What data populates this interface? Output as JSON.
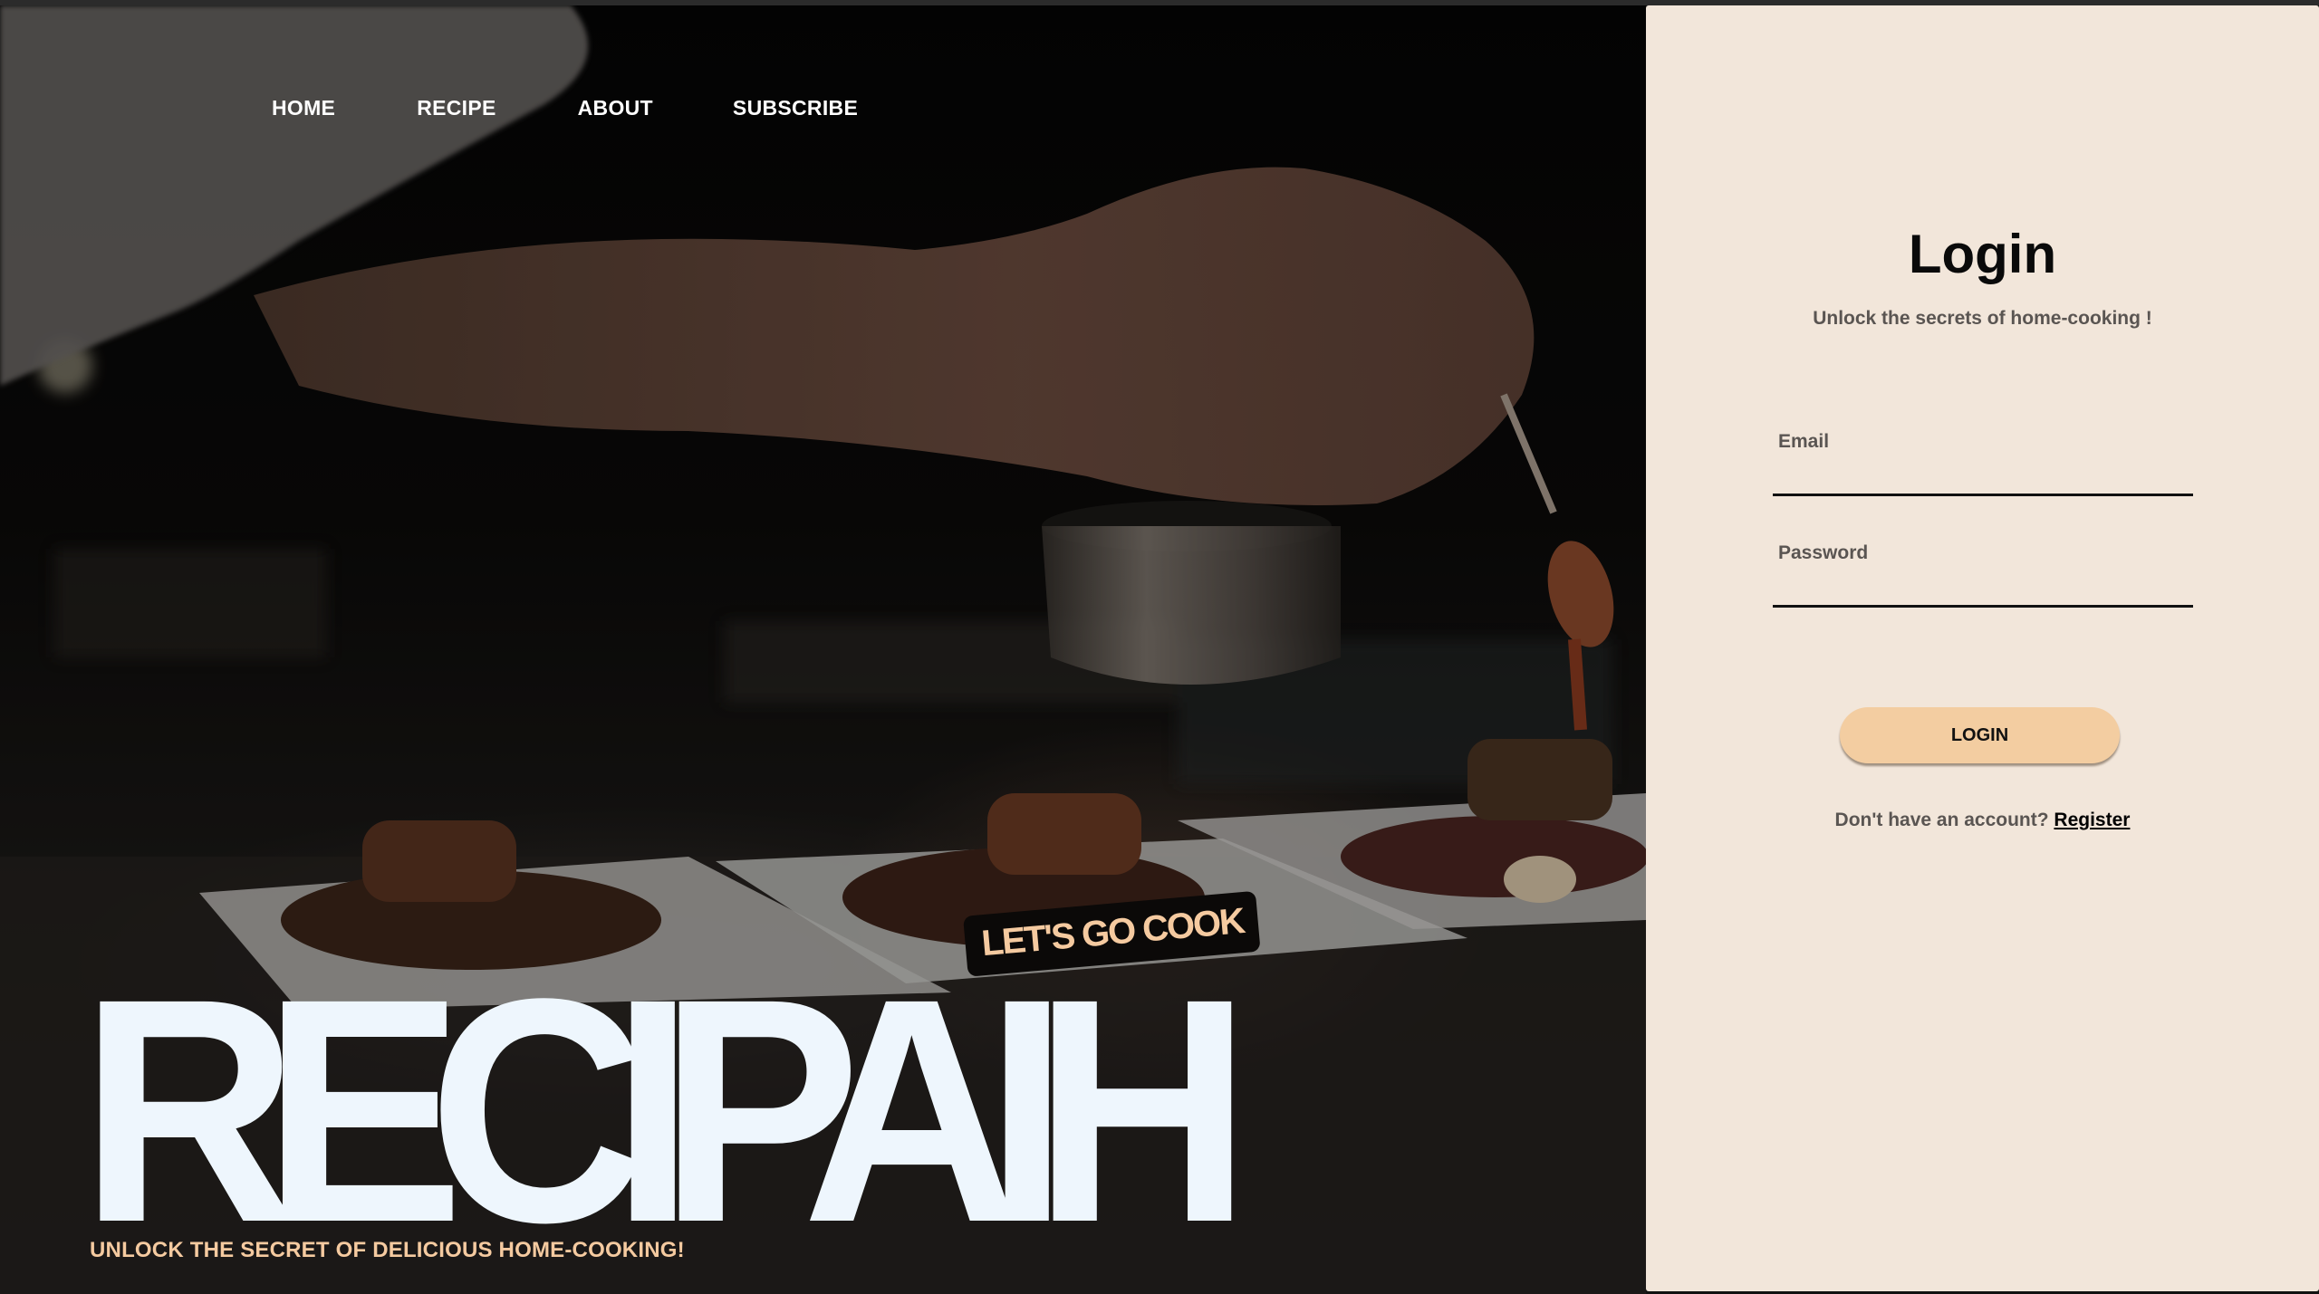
{
  "nav": {
    "items": [
      {
        "label": "HOME"
      },
      {
        "label": "RECIPE"
      },
      {
        "label": "ABOUT"
      },
      {
        "label": "SUBSCRIBE"
      }
    ]
  },
  "hero": {
    "brand": "RECIPAIH",
    "badge": "LET'S GO COOK",
    "tagline": "UNLOCK THE SECRET OF DELICIOUS HOME-COOKING!",
    "background_image": "chef-plating-steak-photo"
  },
  "login": {
    "title": "Login",
    "subtitle": "Unlock the secrets of home-cooking !",
    "email_label": "Email",
    "email_value": "",
    "password_label": "Password",
    "password_value": "",
    "button_label": "LOGIN",
    "register_prompt": "Don't have an account?",
    "register_link": "Register"
  },
  "colors": {
    "panel_bg": "#f2e6da",
    "accent": "#f3cda1",
    "brand_text": "#eef6fd",
    "tagline": "#f5caa0"
  }
}
